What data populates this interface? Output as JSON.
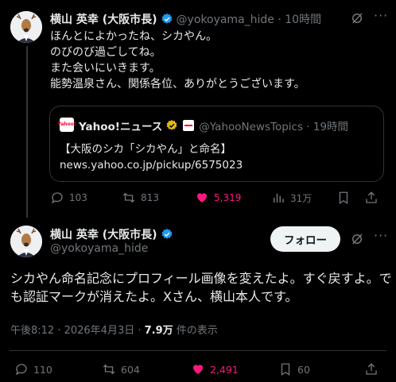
{
  "reply_tweet": {
    "author_name": "横山 英幸 (大阪市長)",
    "handle_time": "@yokoyama_hide · 10時間",
    "lines": [
      "ほんとによかったね、シカやん。",
      "のびのび過ごしてね。",
      "また会いにいきます。",
      "能勢温泉さん、関係各位、ありがとうございます。"
    ],
    "quote": {
      "source_name": "Yahoo!ニュース",
      "logo_text": "Yahoo!",
      "handle_time": "@YahooNewsTopics · 19時間",
      "headline": "【大阪のシカ「シカやん」と命名】",
      "link": "news.yahoo.co.jp/pickup/6575023"
    },
    "actions": {
      "reply_count": "103",
      "retweet_count": "813",
      "like_count": "5,319",
      "views_count": "31万"
    }
  },
  "main_tweet": {
    "author_name": "横山 英幸 (大阪市長)",
    "handle": "@yokoyama_hide",
    "follow_label": "フォロー",
    "text": "シカやん命名記念にプロフィール画像を変えたよ。すぐ戻すよ。でも認証マークが消えたよ。Xさん、横山本人です。",
    "timestamp": "午後8:12 · 2026年4月3日 · ",
    "views_number": "7.9万",
    "views_suffix": " 件の表示",
    "actions": {
      "reply_count": "110",
      "retweet_count": "604",
      "like_count": "2,491",
      "bookmark_count": "60"
    }
  },
  "colors": {
    "background": "#000000",
    "text": "#e7e9ea",
    "muted": "#71767b",
    "like": "#f91880",
    "verified_blue": "#1d9bf0",
    "gold_badge": "#e2b719"
  }
}
